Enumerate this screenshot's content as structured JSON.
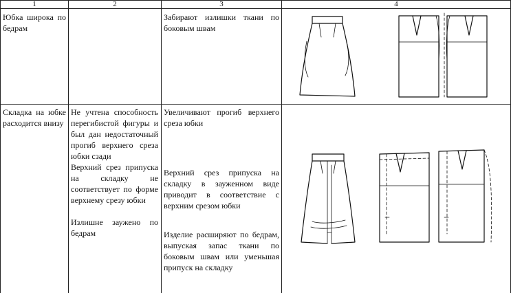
{
  "table": {
    "column_numbers": [
      "1",
      "2",
      "3",
      "4"
    ],
    "rows": [
      {
        "defect": "Юбка широка по бедрам",
        "causes": [],
        "remedies": [
          "Забирают излишки ткани по боковым швам"
        ],
        "figures": [
          "skirt-front-view-icon",
          "skirt-pattern-side-seams-icon"
        ]
      },
      {
        "defect": "Складка на юбке расходится внизу",
        "causes": [
          "Не учтена способность перегибистой фигуры и был дан недостаточный прогиб верхнего среза юбки сзади",
          "Верхний срез припуска на складку не соответствует по форме верхнему срезу юбки",
          "Излишне заужено по бедрам"
        ],
        "remedies": [
          "Увеличивают прогиб верхнего среза юбки",
          "Верхний срез припуска на складку в зауженном виде приводит в соответствие с верхним срезом юбки",
          "Изделие расширяют по бедрам, выпуская запас ткани по боковым швам или уменьшая припуск на складку"
        ],
        "figures": [
          "skirt-back-pleat-view-icon",
          "skirt-back-pattern-icon",
          "skirt-back-pattern-widened-icon"
        ]
      }
    ]
  }
}
